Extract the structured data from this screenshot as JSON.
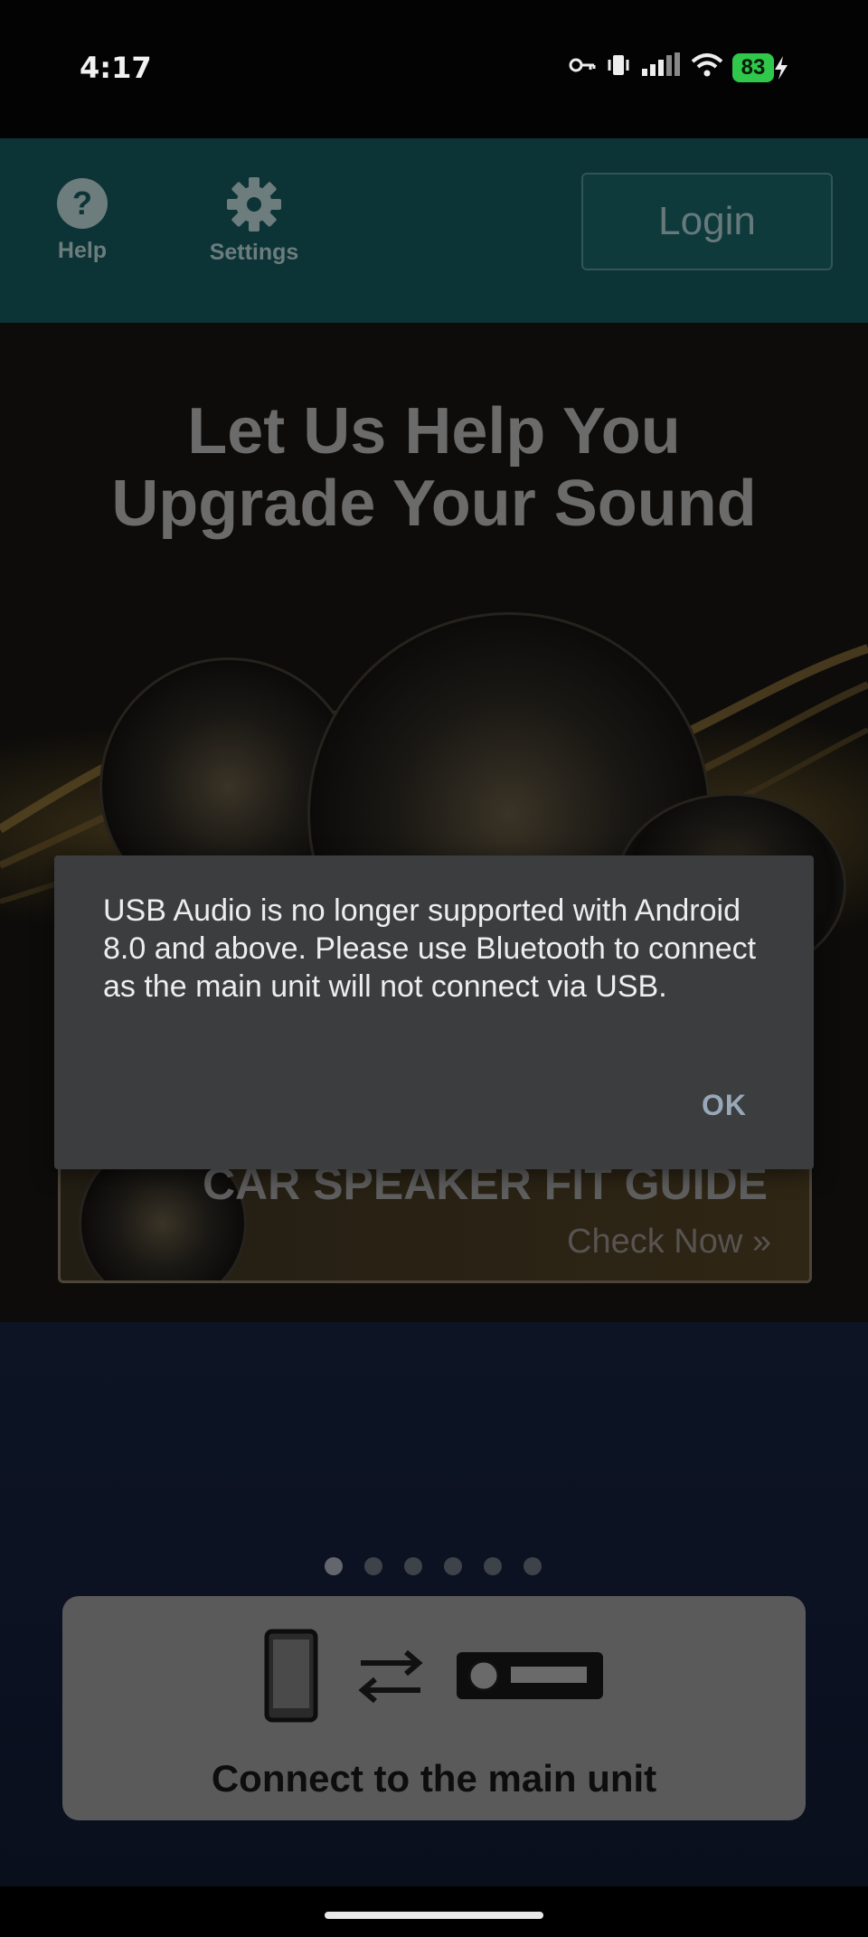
{
  "status_bar": {
    "time": "4:17",
    "battery_level": "83",
    "icons": [
      "vpn-key-icon",
      "vibrate-icon",
      "signal-icon",
      "wifi-icon",
      "battery-icon",
      "charging-bolt-icon"
    ]
  },
  "header": {
    "help_label": "Help",
    "settings_label": "Settings",
    "login_label": "Login"
  },
  "banner": {
    "title_line1": "Let Us Help You",
    "title_line2": "Upgrade Your Sound",
    "fit_guide_title": "CAR SPEAKER FIT GUIDE",
    "fit_guide_cta": "Check Now »"
  },
  "carousel": {
    "page_count": 6,
    "active_index": 0
  },
  "connect_card": {
    "label": "Connect to the main unit"
  },
  "dialog": {
    "message": "USB Audio is no longer supported with Android 8.0 and above. Please use Bluetooth to connect as the main unit will not connect via USB.",
    "ok_label": "OK"
  },
  "colors": {
    "header_bg": "#0c3436",
    "dialog_bg": "#3b3d3f",
    "dialog_button": "#98a8b8",
    "battery": "#30c84a"
  }
}
